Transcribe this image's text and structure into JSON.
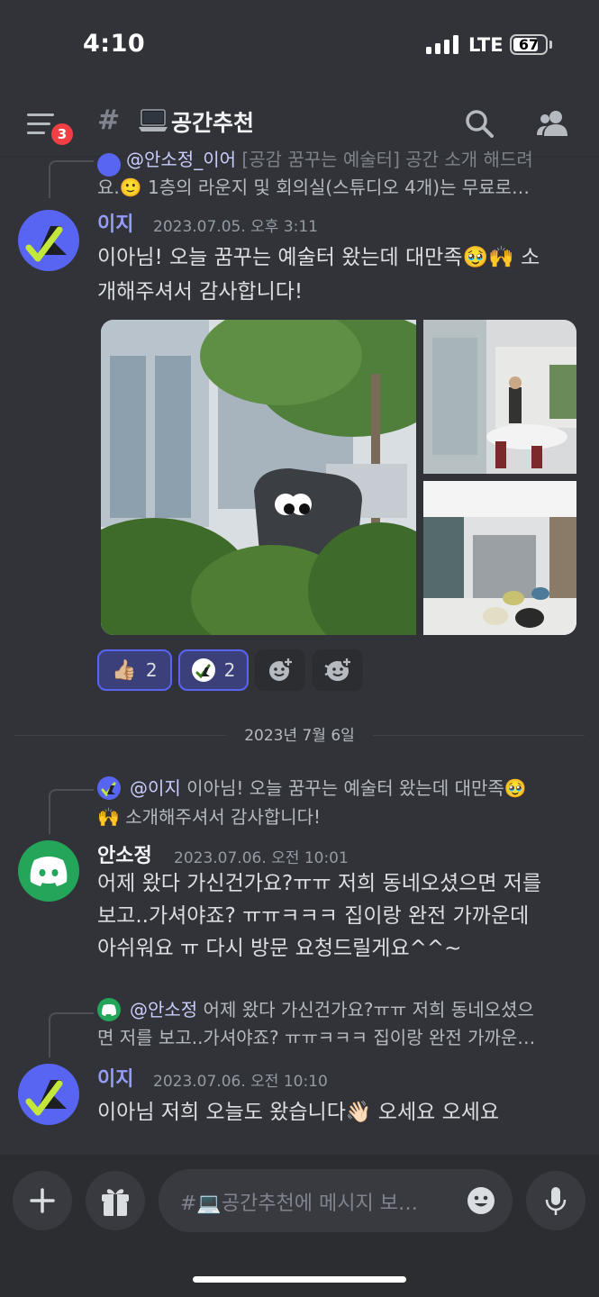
{
  "status_bar": {
    "time": "4:10",
    "network": "LTE",
    "battery": "67"
  },
  "header": {
    "channel_emoji": "laptop-icon",
    "channel_name": "공간추천",
    "unread_badge": "3",
    "icons": [
      "menu-icon",
      "search-icon",
      "members-icon"
    ]
  },
  "messages": [
    {
      "reply": {
        "author": "@안소정_이어",
        "line1": "[공감 꿈꾸는 예술터] 공간 소개 해드려",
        "line2": "요.🙂  1층의 라운지 및 회의실(스튜디오 4개)는 무료로…"
      },
      "author": "이지",
      "timestamp": "2023.07.05. 오후 3:11",
      "lines": [
        "이아님! 오늘 꿈꾸는 예술터 왔는데 대만족🥹🙌 소",
        "개해주셔서 감사합니다!"
      ],
      "reactions": [
        {
          "emoji": "👍🏼",
          "count": "2"
        },
        {
          "emoji": "avatar",
          "count": "2"
        }
      ]
    },
    {
      "reply": {
        "author": "@이지",
        "line1": " 이아님! 오늘 꿈꾸는 예술터 왔는데 대만족🥹",
        "line2": "🙌 소개해주셔서 감사합니다!"
      },
      "author": "안소정",
      "timestamp": "2023.07.06. 오전 10:01",
      "lines": [
        "어제 왔다 가신건가요?ㅠㅠ 저희 동네오셨으면 저를",
        "보고..가셔야죠? ㅠㅠㅋㅋㅋ  집이랑 완전 가까운데",
        "아쉬워요 ㅠ 다시 방문 요청드릴게요^^~"
      ]
    },
    {
      "reply": {
        "author": "@안소정",
        "line1": " 어제 왔다 가신건가요?ㅠㅠ 저희 동네오셨으",
        "line2": "면 저를 보고..가셔야죠? ㅠㅠㅋㅋㅋ  집이랑 완전 가까운…"
      },
      "author": "이지",
      "timestamp": "2023.07.06. 오전 10:10",
      "lines": [
        "이아님 저희 오늘도 왔습니다👋🏻 오세요 오세요"
      ]
    }
  ],
  "date_divider": "2023년 7월 6일",
  "composer": {
    "placeholder": "#💻공간추천에 메시지 보…"
  },
  "colors": {
    "background": "#313338",
    "accent": "#5865f2",
    "author_blurple": "#949cf7",
    "badge_red": "#f23f43",
    "discord_green": "#23a55a"
  }
}
